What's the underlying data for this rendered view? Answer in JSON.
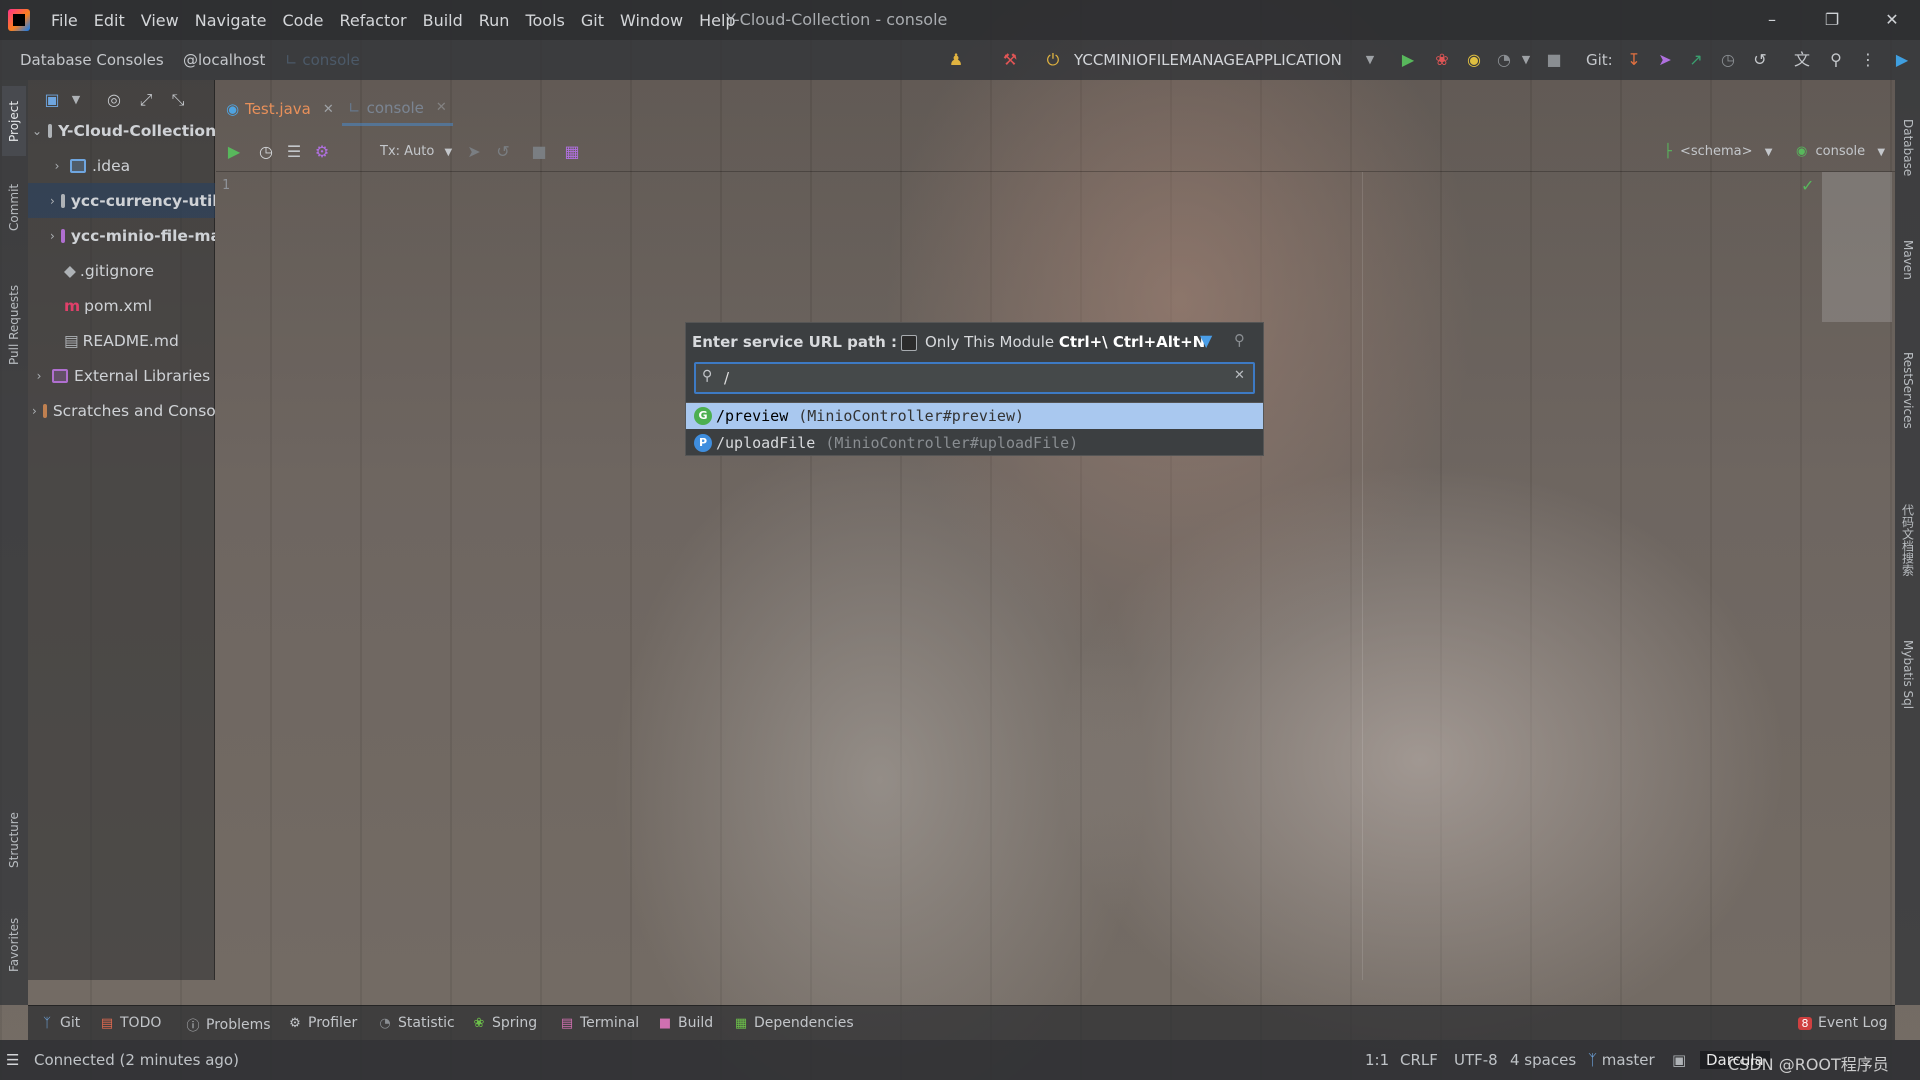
{
  "window": {
    "title": "Y-Cloud-Collection - console",
    "menu": [
      "File",
      "Edit",
      "View",
      "Navigate",
      "Code",
      "Refactor",
      "Build",
      "Run",
      "Tools",
      "Git",
      "Window",
      "Help"
    ]
  },
  "nav": {
    "crumb1": "Database Consoles",
    "crumb2": "@localhost",
    "crumb3": "console",
    "run_config": "YCCMINIOFILEMANAGEAPPLICATION",
    "git_label": "Git:"
  },
  "left_tabs": [
    "Project",
    "Commit",
    "Pull Requests",
    "Structure",
    "Favorites"
  ],
  "right_tabs": [
    "Database",
    "Maven",
    "RestServices",
    "代码文档搜索",
    "Mybatis Sql"
  ],
  "project": {
    "items": [
      {
        "label": "Y-Cloud-Collection",
        "bold": true
      },
      {
        "label": ".idea"
      },
      {
        "label": "ycc-currency-util",
        "bold": true
      },
      {
        "label": "ycc-minio-file-manage",
        "bold": true
      },
      {
        "label": ".gitignore"
      },
      {
        "label": "pom.xml"
      },
      {
        "label": "README.md"
      },
      {
        "label": "External Libraries"
      },
      {
        "label": "Scratches and Consoles"
      }
    ]
  },
  "editor": {
    "tabs": [
      {
        "label": "Test.java"
      },
      {
        "label": "console"
      }
    ],
    "tx_mode": "Tx: Auto",
    "schema": "<schema>",
    "console_select": "console",
    "line_number": "1"
  },
  "popup": {
    "label": "Enter service URL path :",
    "only_module": "Only This Module",
    "shortcut": "Ctrl+\\ Ctrl+Alt+N",
    "search_value": "/",
    "results": [
      {
        "method": "G",
        "path": "/preview",
        "hint": "(MinioController#preview)",
        "color": "#4caf50"
      },
      {
        "method": "P",
        "path": "/uploadFile",
        "hint": "(MinioController#uploadFile)",
        "color": "#3f8ede"
      }
    ]
  },
  "bottom_tabs": [
    "Git",
    "TODO",
    "Problems",
    "Profiler",
    "Statistic",
    "Spring",
    "Terminal",
    "Build",
    "Dependencies"
  ],
  "event_log": {
    "count": "8",
    "label": "Event Log"
  },
  "status": {
    "message": "Connected (2 minutes ago)",
    "position": "1:1",
    "line_sep": "CRLF",
    "encoding": "UTF-8",
    "indent": "4 spaces",
    "branch": "master",
    "theme": "Darcula",
    "watermark": "CSDN @ROOT程序员"
  }
}
